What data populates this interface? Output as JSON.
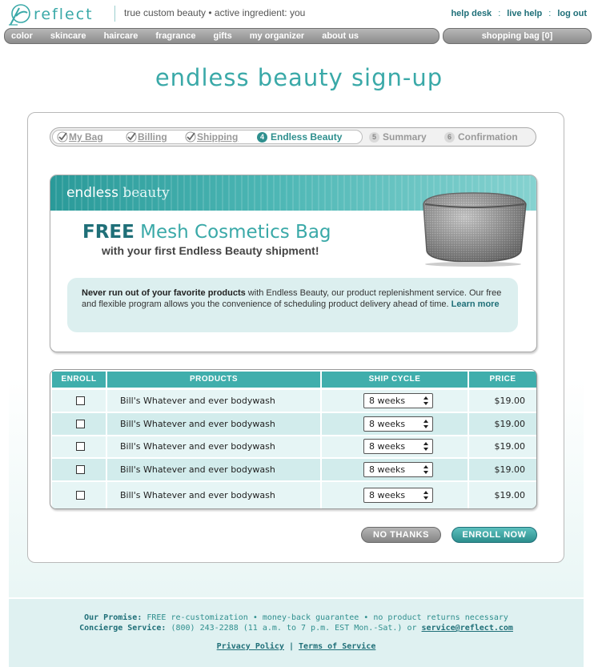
{
  "brand": {
    "logo_text": "reflect",
    "tagline": "true custom beauty • active ingredient: you"
  },
  "utility_links": [
    "help desk",
    "live help",
    "log out"
  ],
  "utility_separator": ":",
  "nav": {
    "items": [
      "color",
      "skincare",
      "haircare",
      "fragrance",
      "gifts",
      "my organizer",
      "about us"
    ],
    "shopping_bag": "shopping bag [0]"
  },
  "page_title": "endless beauty sign-up",
  "steps": [
    {
      "label": "My Bag",
      "state": "done"
    },
    {
      "label": "Billing",
      "state": "done"
    },
    {
      "label": "Shipping",
      "state": "done"
    },
    {
      "number": "4",
      "label": "Endless Beauty",
      "state": "current"
    },
    {
      "number": "5",
      "label": "Summary",
      "state": "future"
    },
    {
      "number": "6",
      "label": "Confirmation",
      "state": "future"
    }
  ],
  "promo": {
    "logo_bold": "endless",
    "logo_light": "beauty",
    "headline_bold": "FREE",
    "headline_rest": "Mesh Cosmetics Bag",
    "subline": "with your first Endless Beauty shipment!",
    "desc_bold": "Never run out of your favorite products",
    "desc_rest": " with Endless Beauty, our product replenishment service. Our free and flexible program allows you the convenience of scheduling product delivery ahead of time. ",
    "learn_more": "Learn more"
  },
  "table": {
    "headers": [
      "ENROLL",
      "PRODUCTS",
      "SHIP CYCLE",
      "PRICE"
    ],
    "rows": [
      {
        "product": "Bill's Whatever and ever bodywash",
        "cycle": "8 weeks",
        "price": "$19.00",
        "checked": false
      },
      {
        "product": "Bill's Whatever and ever bodywash",
        "cycle": "8 weeks",
        "price": "$19.00",
        "checked": false
      },
      {
        "product": "Bill's Whatever and ever bodywash",
        "cycle": "8 weeks",
        "price": "$19.00",
        "checked": false
      },
      {
        "product": "Bill's Whatever and ever bodywash",
        "cycle": "8 weeks",
        "price": "$19.00",
        "checked": false
      },
      {
        "product": "Bill's Whatever and ever bodywash",
        "cycle": "8 weeks",
        "price": "$19.00",
        "checked": false
      }
    ]
  },
  "buttons": {
    "no_thanks": "NO THANKS",
    "enroll_now": "ENROLL NOW"
  },
  "footer": {
    "promise_label": "Our Promise:",
    "promise_text": " FREE re-customization • money-back guarantee • no product returns necessary",
    "concierge_label": "Concierge Service:",
    "concierge_text": " (800) 243-2288 (11 a.m. to 7 p.m. EST Mon.-Sat.) or ",
    "email": "service@reflect.com",
    "privacy": "Privacy Policy",
    "terms": "Terms of Service",
    "link_separator": " | "
  },
  "colors": {
    "accent": "#3aa9a8",
    "dark_teal": "#1f6f78",
    "nav_grey": "#8c8c8c"
  }
}
